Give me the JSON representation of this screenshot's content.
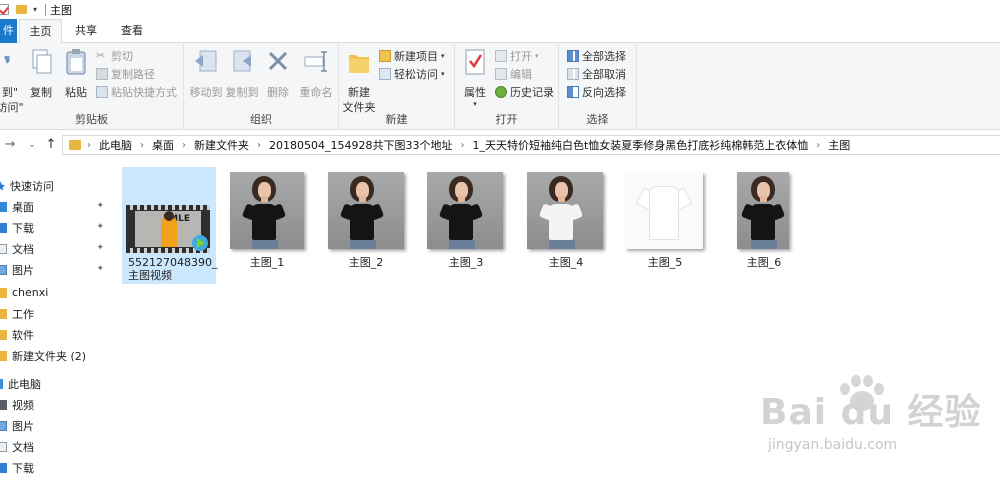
{
  "window": {
    "title": "主图"
  },
  "tabs": {
    "file": "件",
    "home": "主页",
    "share": "共享",
    "view": "查看"
  },
  "ribbon": {
    "clipboard": {
      "label": "剪贴板",
      "pin_line1": "到\"",
      "pin_line2": "访问\"",
      "copy": "复制",
      "paste": "粘贴",
      "cut": "剪切",
      "copy_path": "复制路径",
      "paste_shortcut": "粘贴快捷方式"
    },
    "organize": {
      "label": "组织",
      "move_to": "移动到",
      "copy_to": "复制到",
      "delete": "删除",
      "rename": "重命名"
    },
    "new": {
      "label": "新建",
      "new_folder_line1": "新建",
      "new_folder_line2": "文件夹",
      "new_item": "新建项目",
      "easy_access": "轻松访问"
    },
    "open": {
      "label": "打开",
      "properties": "属性",
      "open": "打开",
      "edit": "编辑",
      "history": "历史记录"
    },
    "select": {
      "label": "选择",
      "select_all": "全部选择",
      "select_none": "全部取消",
      "invert": "反向选择"
    }
  },
  "breadcrumb": [
    "此电脑",
    "桌面",
    "新建文件夹",
    "20180504_154928共下图33个地址",
    "1_天天特价短袖纯白色t恤女装夏季修身黑色打底衫纯棉韩范上衣体恤",
    "主图"
  ],
  "nav": {
    "quick_access": "快速访问",
    "quick_items": [
      "桌面",
      "下载",
      "文档",
      "图片"
    ],
    "folders": [
      "chenxi",
      "工作",
      "软件",
      "新建文件夹 (2)"
    ],
    "this_pc": "此电脑",
    "pc_items": [
      "视频",
      "图片",
      "文档",
      "下载"
    ]
  },
  "files": [
    {
      "name_line1": "552127048390_",
      "name_line2": "主图视频",
      "type": "video",
      "selected": true
    },
    {
      "name": "主图_1",
      "shirt": "black"
    },
    {
      "name": "主图_2",
      "shirt": "black"
    },
    {
      "name": "主图_3",
      "shirt": "black"
    },
    {
      "name": "主图_4",
      "shirt": "white"
    },
    {
      "name": "主图_5",
      "shirt": "white-flat"
    },
    {
      "name": "主图_6",
      "shirt": "black"
    }
  ],
  "video_thumb_text": "EMLE",
  "watermark": {
    "brand": "Bai du 经验",
    "url": "jingyan.baidu.com"
  },
  "colors": {
    "accent": "#1979ca",
    "folder": "#e8b640",
    "selection": "#cce8ff"
  }
}
